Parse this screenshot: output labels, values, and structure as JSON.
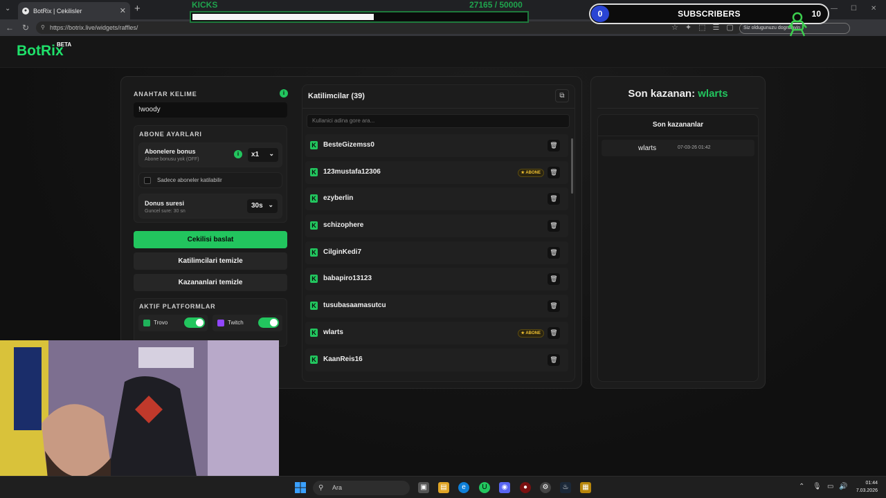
{
  "browser": {
    "tab_title": "BotRix | Cekilisler",
    "url": "https://botrix.live/widgets/raffles/",
    "notice_text": "Siz oldugunuzu dogrulayin"
  },
  "overlay": {
    "kicks_label": "KICKS",
    "kicks_current": "27165",
    "kicks_goal": "/ 50000",
    "kicks_progress": 0.543,
    "subscribers_label": "SUBSCRIBERS",
    "subscribers_count": "0",
    "subscribers_goal": "10"
  },
  "app": {
    "logo": "BotRix",
    "beta": "BETA"
  },
  "left": {
    "keyword_label": "ANAHTAR KELIME",
    "keyword_value": "!woody",
    "sub_settings_label": "ABONE AYARLARI",
    "sub_bonus_title": "Abonelere bonus",
    "sub_bonus_sub": "Abone bonusu yok (OFF)",
    "sub_bonus_select": "x1",
    "only_subs_label": "Sadece aboneler katilabilir",
    "duration_title": "Donus suresi",
    "duration_sub": "Guncel sure: 30 sn",
    "duration_select": "30s",
    "start_button": "Cekilisi baslat",
    "clear_participants_button": "Katilimcilari temizle",
    "clear_winners_button": "Kazananlari temizle",
    "platforms_label": "AKTIF PLATFORMLAR",
    "platform_1": "Trovo",
    "platform_2": "Twitch",
    "platform_1_on": true,
    "platform_2_on": true
  },
  "participants": {
    "title": "Katilimcilar (39)",
    "search_placeholder": "Kullanici adina gore ara...",
    "badge_label": "ABONE",
    "list": [
      {
        "name": "BesteGizemss0",
        "subscriber": false
      },
      {
        "name": "123mustafa12306",
        "subscriber": true
      },
      {
        "name": "ezyberlin",
        "subscriber": false
      },
      {
        "name": "schizophere",
        "subscriber": false
      },
      {
        "name": "CilginKedi7",
        "subscriber": false
      },
      {
        "name": "babapiro13123",
        "subscriber": false
      },
      {
        "name": "tusubasaamasutcu",
        "subscriber": false
      },
      {
        "name": "wlarts",
        "subscriber": true
      },
      {
        "name": "KaanReis16",
        "subscriber": false
      }
    ]
  },
  "winners": {
    "last_winner_prefix": "Son kazanan:",
    "last_winner_name": "wlarts",
    "list_title": "Son kazananlar",
    "rows": [
      {
        "name": "wlarts",
        "date": "07-03-26 01:42"
      }
    ]
  },
  "taskbar": {
    "search_label": "Ara",
    "time": "01:44",
    "date": "7.03.2026"
  },
  "colors": {
    "accent": "#22c55e",
    "background": "#141414",
    "subscriber_badge": "#f1c232"
  }
}
